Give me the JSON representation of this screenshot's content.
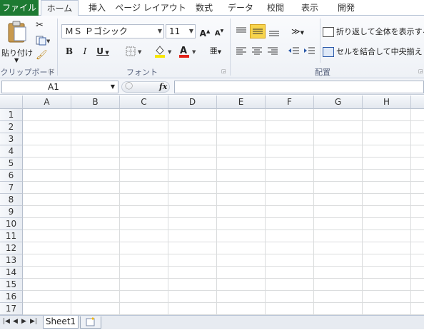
{
  "tabs": [
    "ファイル",
    "ホーム",
    "挿入",
    "ページ レイアウト",
    "数式",
    "データ",
    "校閲",
    "表示",
    "開発"
  ],
  "clipboard": {
    "paste_label": "貼り付け",
    "group_label": "クリップボード"
  },
  "font": {
    "name": "ＭＳ Ｐゴシック",
    "size": "11",
    "group_label": "フォント"
  },
  "alignment": {
    "wrap_label": "折り返して全体を表示する",
    "merge_label": "セルを結合して中央揃え",
    "group_label": "配置"
  },
  "formula_bar": {
    "name_box": "A1",
    "fx": "fx",
    "value": ""
  },
  "columns": [
    "A",
    "B",
    "C",
    "D",
    "E",
    "F",
    "G",
    "H"
  ],
  "rows": [
    "1",
    "2",
    "3",
    "4",
    "5",
    "6",
    "7",
    "8",
    "9",
    "10",
    "11",
    "12",
    "13",
    "14",
    "15",
    "16",
    "17"
  ],
  "sheets": [
    "Sheet1"
  ],
  "colors": {
    "file_tab": "#1d7a32",
    "highlight": "#f7d44c",
    "font_color": "#e2231a"
  }
}
